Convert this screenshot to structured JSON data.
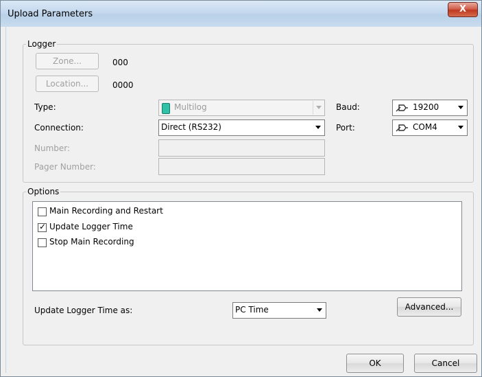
{
  "window": {
    "title": "Upload Parameters",
    "close_glyph": "X"
  },
  "logger": {
    "legend": "Logger",
    "zone_button": "Zone...",
    "zone_value": "000",
    "location_button": "Location...",
    "location_value": "0000",
    "type_label": "Type:",
    "type_value": "Multilog",
    "type_icon": "multilog-device-icon",
    "connection_label": "Connection:",
    "connection_value": "Direct (RS232)",
    "baud_label": "Baud:",
    "baud_value": "19200",
    "baud_icon": "serial-cable-icon",
    "port_label": "Port:",
    "port_value": "COM4",
    "port_icon": "serial-cable-icon",
    "number_label": "Number:",
    "pager_label": "Pager Number:"
  },
  "options": {
    "legend": "Options",
    "items": [
      {
        "label": "Main Recording and Restart",
        "checked": false
      },
      {
        "label": "Update Logger Time",
        "checked": true
      },
      {
        "label": "Stop Main Recording",
        "checked": false
      }
    ],
    "update_time_label": "Update Logger Time as:",
    "update_time_value": "PC Time",
    "advanced_button": "Advanced..."
  },
  "footer": {
    "ok_button": "OK",
    "cancel_button": "Cancel"
  }
}
